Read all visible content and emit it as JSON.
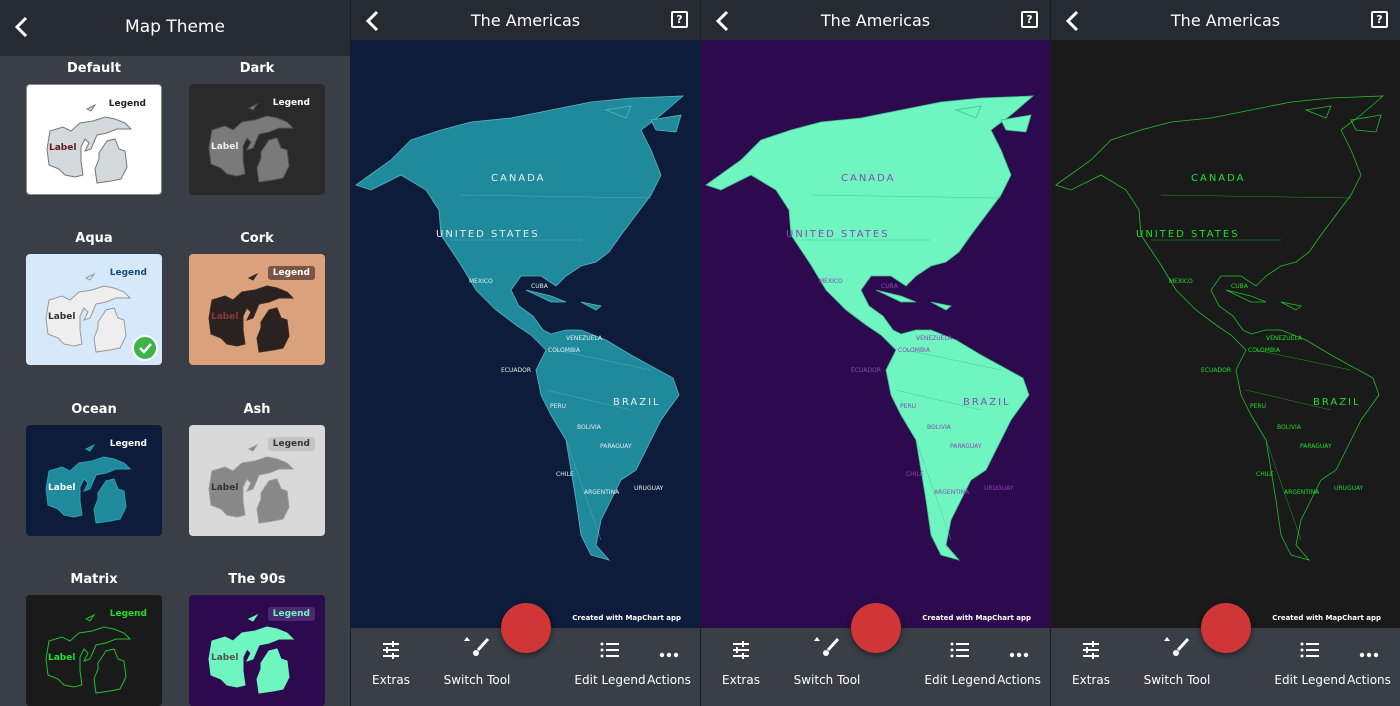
{
  "theme_screen": {
    "title": "Map Theme",
    "selected": "Aqua",
    "themes": [
      {
        "name": "Default",
        "legend": "Legend",
        "label": "Label",
        "bg": "#ffffff",
        "land": "#d3d9dc",
        "stroke": "#777777",
        "text": "#222222",
        "labelColor": "#5a1a1a",
        "legendBg": "transparent"
      },
      {
        "name": "Dark",
        "legend": "Legend",
        "label": "Label",
        "bg": "#2a2a2a",
        "land": "#7a7a7a",
        "stroke": "#555555",
        "text": "#ffffff",
        "labelColor": "#eeeeee",
        "legendBg": "transparent"
      },
      {
        "name": "Aqua",
        "legend": "Legend",
        "label": "Label",
        "bg": "#d6e9fb",
        "land": "#eeeeee",
        "stroke": "#999999",
        "text": "#1a4a7a",
        "labelColor": "#333333",
        "legendBg": "transparent"
      },
      {
        "name": "Cork",
        "legend": "Legend",
        "label": "Label",
        "bg": "#d9a27c",
        "land": "#2a2220",
        "stroke": "#3a2a22",
        "text": "#ffffff",
        "labelColor": "#8a3a3a",
        "legendBg": "#7a5444"
      },
      {
        "name": "Ocean",
        "legend": "Legend",
        "label": "Label",
        "bg": "#0c1c3a",
        "land": "#1f8a9b",
        "stroke": "#2aa0b0",
        "text": "#ffffff",
        "labelColor": "#ffffff",
        "legendBg": "transparent"
      },
      {
        "name": "Ash",
        "legend": "Legend",
        "label": "Label",
        "bg": "#d9d9d9",
        "land": "#888888",
        "stroke": "#999999",
        "text": "#333333",
        "labelColor": "#333333",
        "legendBg": "#c4c4c4"
      },
      {
        "name": "Matrix",
        "legend": "Legend",
        "label": "Label",
        "bg": "#1a1a1a",
        "land": "none",
        "stroke": "#1fbf2a",
        "text": "#1fdf2a",
        "labelColor": "#1fdf2a",
        "legendBg": "transparent"
      },
      {
        "name": "The 90s",
        "legend": "Legend",
        "label": "Label",
        "bg": "#2d0a4e",
        "land": "#6ef5c0",
        "stroke": "#6ef5c0",
        "text": "#6ef5c0",
        "labelColor": "#555555",
        "legendBg": "#4a2a6e"
      }
    ]
  },
  "map_panels": [
    {
      "title": "The Americas",
      "theme": "Ocean",
      "bg": "#0c1c3a",
      "land": "#1f8a9b",
      "stroke": "#5fb3c0",
      "label": "#e6eef2"
    },
    {
      "title": "The Americas",
      "theme": "The 90s",
      "bg": "#2d0a4e",
      "land": "#6ef5c0",
      "stroke": "#3ec090",
      "label": "#8a4ab0"
    },
    {
      "title": "The Americas",
      "theme": "Matrix",
      "bg": "#1a1a1a",
      "land": "none",
      "stroke": "#1fbf2a",
      "label": "#1fdf2a"
    }
  ],
  "map_labels": {
    "big": [
      "CANADA",
      "UNITED STATES",
      "BRAZIL"
    ],
    "small": [
      "MEXICO",
      "CUBA",
      "VENEZUELA",
      "COLOMBIA",
      "ECUADOR",
      "PERU",
      "BOLIVIA",
      "PARAGUAY",
      "CHILE",
      "ARGENTINA",
      "URUGUAY"
    ]
  },
  "credit": "Created with MapChart app",
  "help_icon": "?",
  "toolbar": [
    "Extras",
    "Switch Tool",
    "Edit Legend",
    "Actions"
  ],
  "colors": {
    "header": "#252a33",
    "toolbar": "#3a3e47",
    "fab": "#d03636",
    "check": "#3db34a"
  }
}
